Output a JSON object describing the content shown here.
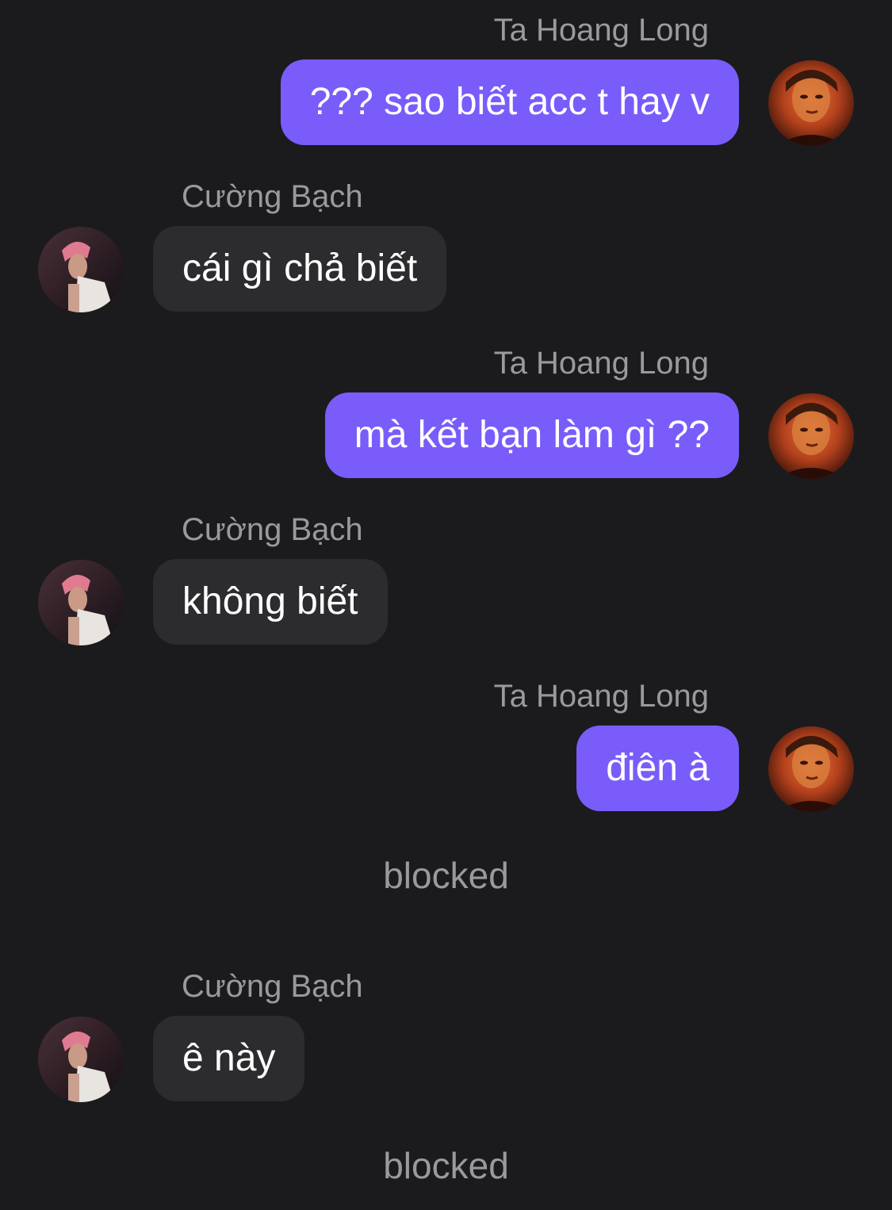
{
  "messages": [
    {
      "sender": "Ta Hoang Long",
      "text": "??? sao biết acc t hay v",
      "direction": "outgoing"
    },
    {
      "sender": "Cường Bạch",
      "text": "cái gì chả biết",
      "direction": "incoming"
    },
    {
      "sender": "Ta Hoang Long",
      "text": "mà kết bạn làm gì ??",
      "direction": "outgoing"
    },
    {
      "sender": "Cường Bạch",
      "text": "không biết",
      "direction": "incoming"
    },
    {
      "sender": "Ta Hoang Long",
      "text": "điên à",
      "direction": "outgoing"
    },
    {
      "system": "blocked"
    },
    {
      "sender": "Cường Bạch",
      "text": "ê này",
      "direction": "incoming"
    },
    {
      "system": "blocked"
    }
  ],
  "colors": {
    "background": "#1b1b1d",
    "outgoing_bubble": "#7a5cfa",
    "incoming_bubble": "#2c2c2f",
    "sender_name": "#9a999e",
    "message_text": "#ffffff"
  },
  "icons": {
    "me_avatar": "user-avatar-icon",
    "other_avatar": "contact-avatar-icon"
  }
}
